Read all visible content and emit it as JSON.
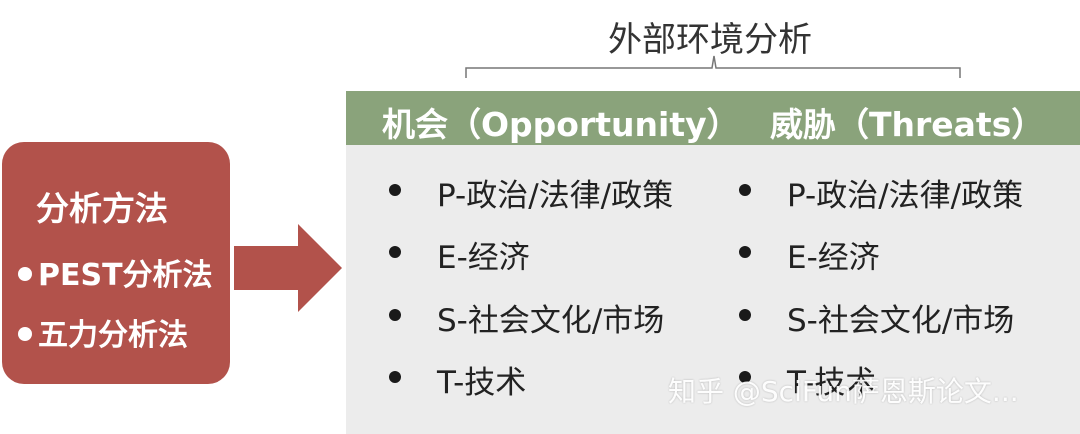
{
  "diagram": {
    "top_title": "外部环境分析",
    "method_box": {
      "title": "分析方法",
      "items": [
        "PEST分析法",
        "五力分析法"
      ]
    },
    "columns": [
      {
        "header": "机会（Opportunity）",
        "factors": [
          "P-政治/法律/政策",
          "E-经济",
          "S-社会文化/市场",
          "T-技术"
        ]
      },
      {
        "header": "威胁（Threats）",
        "factors": [
          "P-政治/法律/政策",
          "E-经济",
          "S-社会文化/市场",
          "T-技术"
        ]
      }
    ],
    "colors": {
      "method_box": "#b2524b",
      "arrow": "#b2524b",
      "header": "#8aa37b",
      "panel": "#ececec"
    }
  },
  "watermark": "知乎 @SciFun萨恩斯论文..."
}
